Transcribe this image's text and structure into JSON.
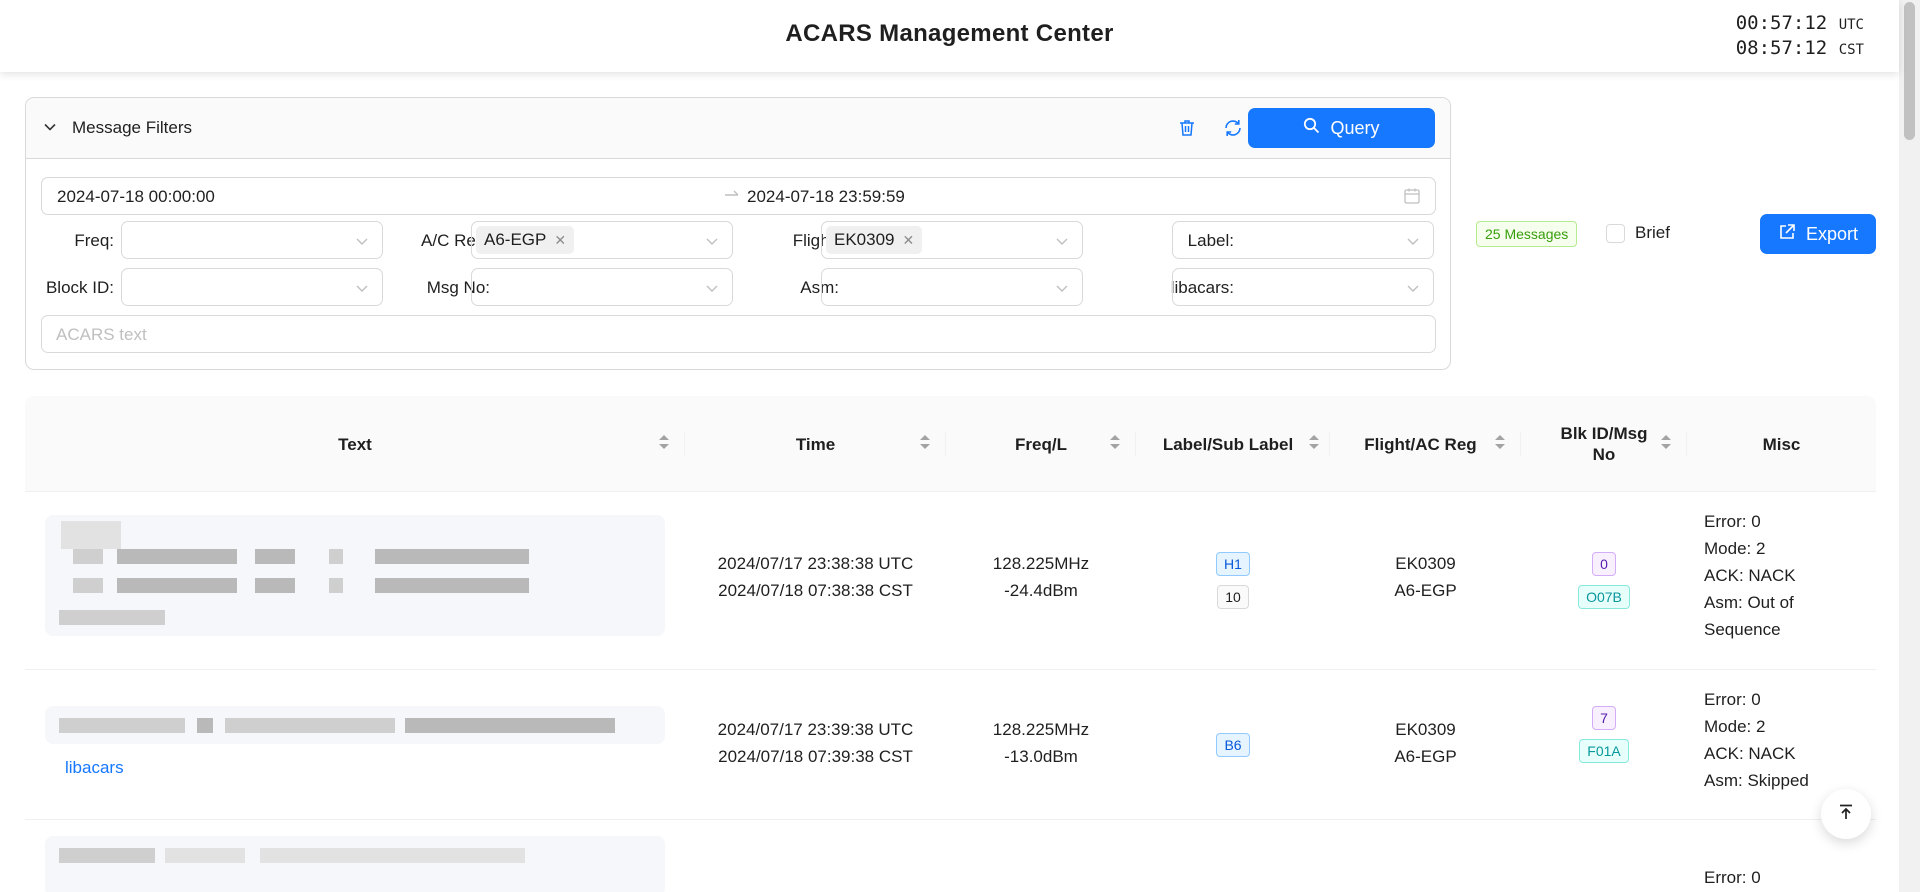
{
  "header": {
    "title": "ACARS Management Center",
    "clock": {
      "utc_time": "00:57:12",
      "utc_label": "UTC",
      "local_time": "08:57:12",
      "local_label": "CST"
    }
  },
  "filters": {
    "panel_title": "Message Filters",
    "query_label": "Query",
    "date_start": "2024-07-18 00:00:00",
    "date_end": "2024-07-18 23:59:59",
    "fields": {
      "freq": {
        "label": "Freq:",
        "value": ""
      },
      "ac_reg": {
        "label": "A/C Reg:",
        "tag": "A6-EGP"
      },
      "flight": {
        "label": "Flight:",
        "tag": "EK0309"
      },
      "label": {
        "label": "Label:",
        "value": ""
      },
      "block_id": {
        "label": "Block ID:",
        "value": ""
      },
      "msg_no": {
        "label": "Msg No:",
        "value": ""
      },
      "asm": {
        "label": "Asm:",
        "value": ""
      },
      "libacars": {
        "label": "libacars:",
        "value": ""
      }
    },
    "text_placeholder": "ACARS text"
  },
  "summary": {
    "count": "25 Messages",
    "brief_label": "Brief",
    "export_label": "Export"
  },
  "table": {
    "columns": [
      "Text",
      "Time",
      "Freq/L",
      "Label/Sub Label",
      "Flight/AC Reg",
      "Blk ID/Msg No",
      "Misc"
    ],
    "rows": [
      {
        "time_utc": "2024/07/17 23:38:38 UTC",
        "time_local": "2024/07/18 07:38:38 CST",
        "freq": "128.225MHz",
        "level": "-24.4dBm",
        "label": "H1",
        "sub_label": "10",
        "flight": "EK0309",
        "reg": "A6-EGP",
        "blk_id": "0",
        "msg_no": "O07B",
        "misc": [
          "Error: 0",
          "Mode: 2",
          "ACK: NACK",
          "Asm: Out of",
          "Sequence"
        ]
      },
      {
        "link": "libacars",
        "time_utc": "2024/07/17 23:39:38 UTC",
        "time_local": "2024/07/18 07:39:38 CST",
        "freq": "128.225MHz",
        "level": "-13.0dBm",
        "label": "B6",
        "flight": "EK0309",
        "reg": "A6-EGP",
        "blk_id": "7",
        "msg_no": "F01A",
        "misc": [
          "Error: 0",
          "Mode: 2",
          "ACK: NACK",
          "Asm: Skipped"
        ]
      },
      {
        "misc": [
          "Error: 0"
        ]
      }
    ]
  },
  "colors": {
    "primary": "#1677ff",
    "success_tag": "#389e0d"
  },
  "icons": [
    "chevron-down-icon",
    "trash-icon",
    "refresh-icon",
    "search-icon",
    "calendar-icon",
    "export-icon",
    "sort-icon",
    "arrow-up-icon"
  ]
}
